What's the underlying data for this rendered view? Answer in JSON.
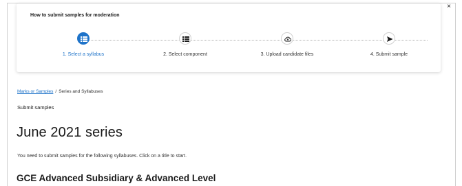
{
  "dialog": {
    "title": "How to submit samples for moderation",
    "close_label": "×"
  },
  "steps": [
    {
      "label": "1. Select a syllabus",
      "icon": "list-icon",
      "active": true
    },
    {
      "label": "2. Select component",
      "icon": "list-icon",
      "active": false
    },
    {
      "label": "3. Upload candidate files",
      "icon": "cloud-upload-icon",
      "active": false
    },
    {
      "label": "4. Submit sample",
      "icon": "send-icon",
      "active": false
    }
  ],
  "breadcrumb": {
    "link": "Marks or Samples",
    "separator": "/",
    "current": "Series and Syllabuses"
  },
  "subheading": "Submit samples",
  "page_title": "June 2021 series",
  "intro": "You need to submit samples for the following syllabuses. Click on a title to start.",
  "section_title": "GCE Advanced Subsidiary & Advanced Level",
  "colors": {
    "accent": "#1e73c9",
    "text": "#1a1a1a"
  }
}
